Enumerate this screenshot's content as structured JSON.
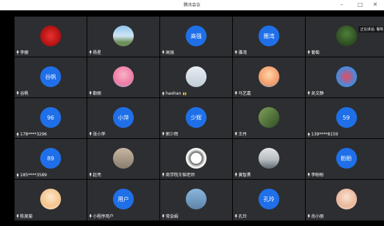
{
  "window": {
    "title": "腾讯会议"
  },
  "speaking_label": "正在讲话: 葡萄",
  "participants": [
    {
      "name": "李娜",
      "avatar_text": "",
      "avatar": "photo-red-festive"
    },
    {
      "name": "杨星",
      "avatar_text": "",
      "avatar": "photo-landscape-sky"
    },
    {
      "name": "高强",
      "avatar_text": "高强",
      "avatar": "text"
    },
    {
      "name": "雅湾",
      "avatar_text": "雅湾",
      "avatar": "text"
    },
    {
      "name": "葡萄",
      "avatar_text": "",
      "avatar": "photo-green-tree"
    },
    {
      "name": "谷帆",
      "avatar_text": "谷帆",
      "avatar": "text"
    },
    {
      "name": "勤丽",
      "avatar_text": "",
      "avatar": "photo-colorful-cartoon"
    },
    {
      "name": "haohan",
      "avatar_text": "",
      "avatar": "photo-snow-figure"
    },
    {
      "name": "马艺嘉",
      "avatar_text": "",
      "avatar": "photo-cartoon-character"
    },
    {
      "name": "吴文静",
      "avatar_text": "",
      "avatar": "photo-cartoon-mickey"
    },
    {
      "name": "178****3296",
      "avatar_text": "96",
      "avatar": "text"
    },
    {
      "name": "张小萍",
      "avatar_text": "小萍",
      "avatar": "text"
    },
    {
      "name": "郭少辉",
      "avatar_text": "少辉",
      "avatar": "text"
    },
    {
      "name": "王丹",
      "avatar_text": "",
      "avatar": "photo-green-plant"
    },
    {
      "name": "139****8159",
      "avatar_text": "59",
      "avatar": "text"
    },
    {
      "name": "185****3589",
      "avatar_text": "89",
      "avatar": "text"
    },
    {
      "name": "赵亮",
      "avatar_text": "",
      "avatar": "photo-group-people"
    },
    {
      "name": "商学院王韬老师",
      "avatar_text": "",
      "avatar": "photo-white-emblem"
    },
    {
      "name": "黄智勇",
      "avatar_text": "",
      "avatar": "photo-grey-landscape"
    },
    {
      "name": "李盼盼",
      "avatar_text": "盼盼",
      "avatar": "text"
    },
    {
      "name": "陈美菊",
      "avatar_text": "",
      "avatar": "photo-cartoon-kid"
    },
    {
      "name": "小程序用户",
      "avatar_text": "用户",
      "avatar": "text"
    },
    {
      "name": "常会娟",
      "avatar_text": "",
      "avatar": "photo-airplane"
    },
    {
      "name": "孔玲",
      "avatar_text": "孔玲",
      "avatar": "text"
    },
    {
      "name": "尚小丽",
      "avatar_text": "",
      "avatar": "photo-child-portrait"
    }
  ]
}
